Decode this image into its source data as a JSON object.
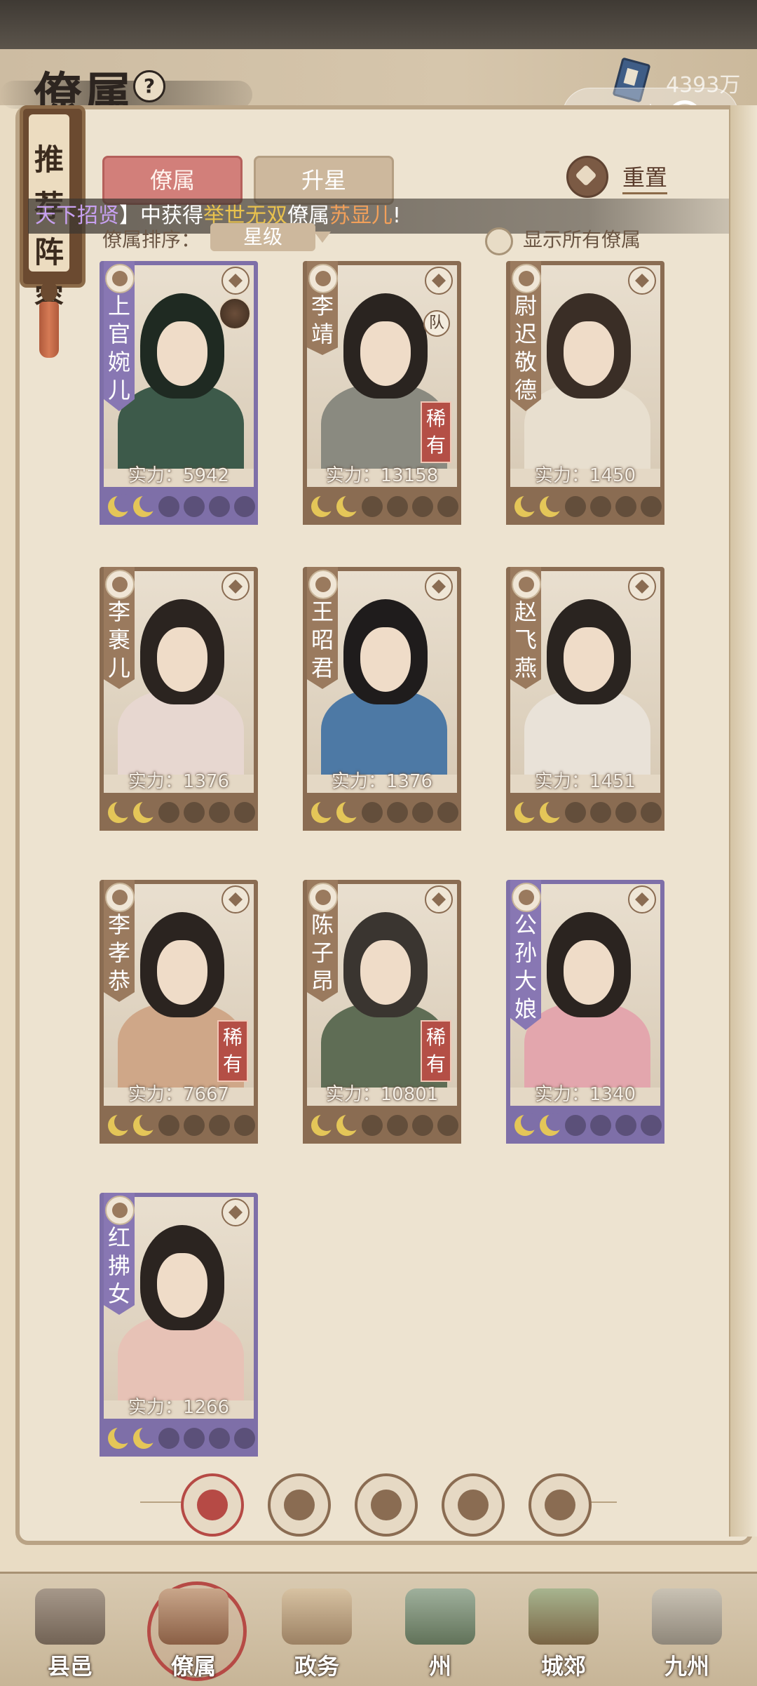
{
  "header": {
    "title": "僚属",
    "currency_amount": "4393万"
  },
  "side_plaque": {
    "label": "推荐阵容"
  },
  "tabs": [
    {
      "label": "僚属",
      "active": true
    },
    {
      "label": "升星",
      "active": false
    }
  ],
  "reset_label": "重置",
  "ticker": {
    "part1": "天下招贤",
    "part2": "】中获得",
    "part3": "举世无双",
    "part4": "僚属",
    "part5": "苏显儿",
    "part6": "!"
  },
  "sort": {
    "label": "僚属排序：",
    "value": "星级"
  },
  "show_all_label": "显示所有僚属",
  "power_prefix": "实力：",
  "rare_label": "稀有",
  "team_label": "队",
  "cards": [
    {
      "name": "上官婉儿",
      "power": "5942",
      "rarity_color": "purple",
      "rare": false,
      "team": false
    },
    {
      "name": "李靖",
      "power": "13158",
      "rarity_color": "brown",
      "rare": true,
      "team": true
    },
    {
      "name": "尉迟敬德",
      "power": "1450",
      "rarity_color": "brown",
      "rare": false,
      "team": false
    },
    {
      "name": "李裹儿",
      "power": "1376",
      "rarity_color": "brown",
      "rare": false,
      "team": false
    },
    {
      "name": "王昭君",
      "power": "1376",
      "rarity_color": "brown",
      "rare": false,
      "team": false
    },
    {
      "name": "赵飞燕",
      "power": "1451",
      "rarity_color": "brown",
      "rare": false,
      "team": false
    },
    {
      "name": "李孝恭",
      "power": "7667",
      "rarity_color": "brown",
      "rare": true,
      "team": false
    },
    {
      "name": "陈子昂",
      "power": "10801",
      "rarity_color": "brown",
      "rare": true,
      "team": false
    },
    {
      "name": "公孙大娘",
      "power": "1340",
      "rarity_color": "purple",
      "rare": false,
      "team": false
    },
    {
      "name": "红拂女",
      "power": "1266",
      "rarity_color": "purple",
      "rare": false,
      "team": false
    }
  ],
  "stars_per_card": {
    "filled": 2,
    "total": 6
  },
  "filters": [
    "all",
    "helmet",
    "gourd",
    "fan",
    "scroll-beast"
  ],
  "nav": [
    {
      "label": "县邑",
      "active": false
    },
    {
      "label": "僚属",
      "active": true
    },
    {
      "label": "政务",
      "active": false
    },
    {
      "label": "州",
      "active": false
    },
    {
      "label": "城郊",
      "active": false
    },
    {
      "label": "九州",
      "active": false
    }
  ]
}
